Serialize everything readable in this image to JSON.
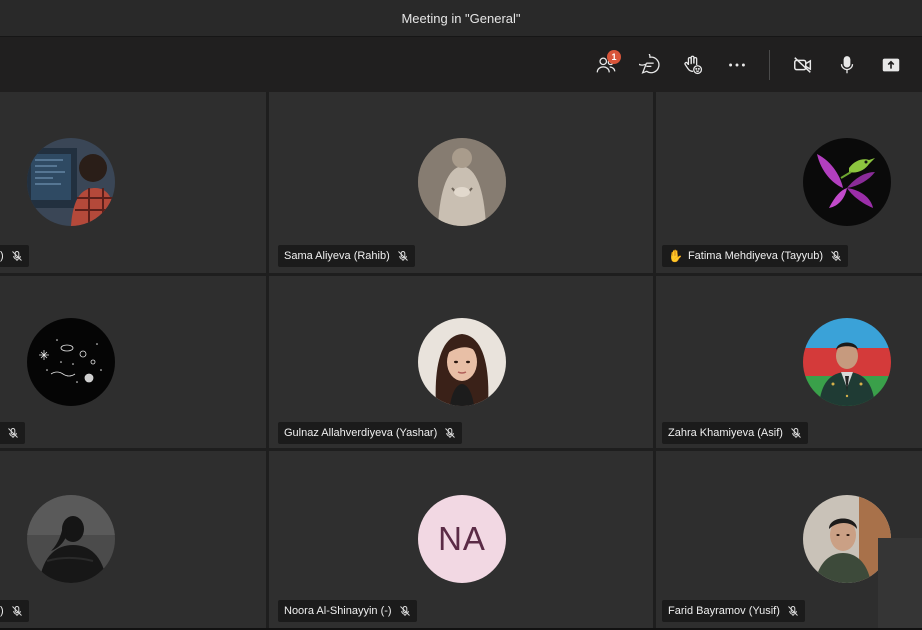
{
  "window": {
    "title": "Meeting in \"General\""
  },
  "toolbar": {
    "participants_badge": "1",
    "buttons": [
      "participants-icon",
      "chat-icon",
      "raise-hand-icon",
      "more-options-icon",
      "camera-off-icon",
      "microphone-icon",
      "share-screen-icon"
    ]
  },
  "tiles": [
    {
      "name": ")",
      "muted": true,
      "avatar": "photo-person-at-computer"
    },
    {
      "name": "Sama Aliyeva (Rahib)",
      "muted": true,
      "avatar": "photo-vintage-figure"
    },
    {
      "name": "Fatima Mehdiyeva (Tayyub)",
      "muted": true,
      "hand_raised": true,
      "hand_icon": "✋",
      "avatar": "illustration-bird-flower"
    },
    {
      "name": "",
      "muted": true,
      "avatar": "drawing-space"
    },
    {
      "name": "Gulnaz Allahverdiyeva (Yashar)",
      "muted": true,
      "avatar": "photo-woman-portrait"
    },
    {
      "name": "Zahra Khamiyeva (Asif)",
      "muted": true,
      "avatar": "photo-man-uniform"
    },
    {
      "name": ")",
      "muted": true,
      "avatar": "photo-silhouette"
    },
    {
      "name": "Noora Al-Shinayyin (-)",
      "muted": true,
      "avatar_initials": "NA"
    },
    {
      "name": "Farid Bayramov (Yusif)",
      "muted": true,
      "avatar": "photo-young-man"
    }
  ],
  "colors": {
    "background": "#1e1e1e",
    "tile": "#2e2e2e",
    "badge": "#d8553a",
    "initials_bg": "#f2d8e3",
    "initials_fg": "#5b2b46"
  }
}
